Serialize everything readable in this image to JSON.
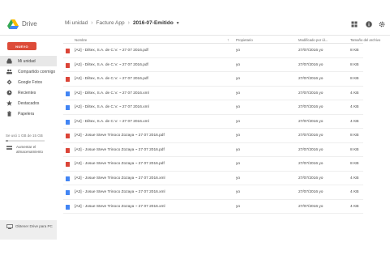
{
  "header": {
    "app_name": "Drive",
    "breadcrumb": [
      "Mi unidad",
      "Facture App",
      "2016-07-Emitido"
    ]
  },
  "sidebar": {
    "new_label": "NUEVO",
    "items": [
      {
        "label": "Mi unidad",
        "icon": "drive-icon",
        "active": true
      },
      {
        "label": "Compartido conmigo",
        "icon": "people-icon"
      },
      {
        "label": "Google Fotos",
        "icon": "photos-icon"
      },
      {
        "label": "Recientes",
        "icon": "clock-icon"
      },
      {
        "label": "Destacados",
        "icon": "star-icon"
      },
      {
        "label": "Papelera",
        "icon": "trash-icon"
      }
    ],
    "storage_text": "Se usó 1 GB de 15 GB",
    "storage_fraction": 0.07,
    "upgrade_label": "Aumentar el almacenamiento",
    "get_drive_label": "Obtener Drive para PC"
  },
  "list": {
    "headers": {
      "name": "Nombre",
      "owner": "Propietario",
      "modified": "Modificado por úl...",
      "size": "Tamaño del archivo"
    },
    "rows": [
      {
        "type": "pdf",
        "name": "[A2] - Diltex, S.A. de C.V. ~ 27 07 2016.pdf",
        "owner": "yo",
        "modified": "27/07/2016 yo",
        "size": "8 KB"
      },
      {
        "type": "pdf",
        "name": "[A2] - Diltex, S.A. de C.V. ~ 27 07 2016.pdf",
        "owner": "yo",
        "modified": "27/07/2016 yo",
        "size": "8 KB"
      },
      {
        "type": "pdf",
        "name": "[A2] - Diltex, S.A. de C.V. ~ 27 07 2016.pdf",
        "owner": "yo",
        "modified": "27/07/2016 yo",
        "size": "8 KB"
      },
      {
        "type": "xml",
        "name": "[A2] - Diltex, S.A. de C.V. ~ 27 07 2016.xml",
        "owner": "yo",
        "modified": "27/07/2016 yo",
        "size": "4 KB"
      },
      {
        "type": "xml",
        "name": "[A2] - Diltex, S.A. de C.V. ~ 27 07 2016.xml",
        "owner": "yo",
        "modified": "27/07/2016 yo",
        "size": "4 KB"
      },
      {
        "type": "xml",
        "name": "[A2] - Diltex, S.A. de C.V. ~ 27 07 2016.xml",
        "owner": "yo",
        "modified": "27/07/2016 yo",
        "size": "4 KB"
      },
      {
        "type": "pdf",
        "name": "[A3] - Josue Steve Trinoco Zozaya ~ 27 07 2016.pdf",
        "owner": "yo",
        "modified": "27/07/2016 yo",
        "size": "8 KB"
      },
      {
        "type": "pdf",
        "name": "[A3] - Josue Steve Trinoco Zozaya ~ 27 07 2016.pdf",
        "owner": "yo",
        "modified": "27/07/2016 yo",
        "size": "8 KB"
      },
      {
        "type": "pdf",
        "name": "[A3] - Josue Steve Trinoco Zozaya ~ 27 07 2016.pdf",
        "owner": "yo",
        "modified": "27/07/2016 yo",
        "size": "8 KB"
      },
      {
        "type": "xml",
        "name": "[A3] - Josue Steve Trinoco Zozaya ~ 27 07 2016.xml",
        "owner": "yo",
        "modified": "27/07/2016 yo",
        "size": "4 KB"
      },
      {
        "type": "xml",
        "name": "[A3] - Josue Steve Trinoco Zozaya ~ 27 07 2016.xml",
        "owner": "yo",
        "modified": "27/07/2016 yo",
        "size": "4 KB"
      },
      {
        "type": "xml",
        "name": "[A3] - Josue Steve Trinoco Zozaya ~ 27 07 2016.xml",
        "owner": "yo",
        "modified": "27/07/2016 yo",
        "size": "4 KB"
      }
    ]
  },
  "colors": {
    "accent_red": "#dd4b39",
    "pdf": "#db4437",
    "xml": "#4285f4"
  }
}
